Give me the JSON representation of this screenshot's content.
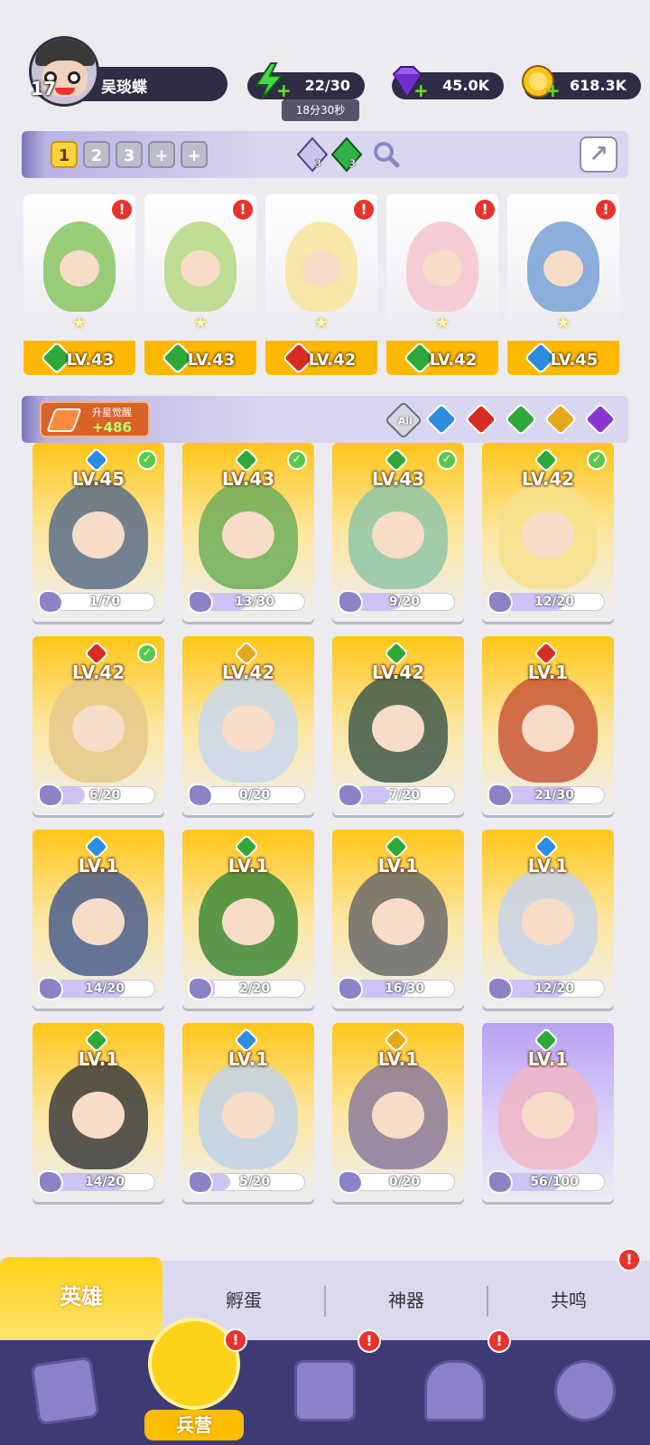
{
  "player": {
    "level": "17",
    "name": "吴琰蝶"
  },
  "resources": {
    "energy": "22/30",
    "energy_timer": "18分30秒",
    "gems": "45.0K",
    "coins": "618.3K"
  },
  "team_tabs": [
    "1",
    "2",
    "3",
    "+",
    "+"
  ],
  "team_gems": {
    "purple_count": "3",
    "green_count": "3"
  },
  "team": [
    {
      "level": "LV.43",
      "element": "green"
    },
    {
      "level": "LV.43",
      "element": "green"
    },
    {
      "level": "LV.42",
      "element": "fire"
    },
    {
      "level": "LV.42",
      "element": "green"
    },
    {
      "level": "LV.45",
      "element": "water"
    }
  ],
  "awaken": {
    "label": "升星觉醒",
    "value": "+486"
  },
  "filters": {
    "all_label": "All",
    "elements": [
      "water",
      "fire",
      "green",
      "light",
      "dark"
    ]
  },
  "heroes": [
    {
      "level": "LV.45",
      "element": "water",
      "shards": "1/70",
      "progress": 0.014,
      "checked": true
    },
    {
      "level": "LV.43",
      "element": "green",
      "shards": "13/30",
      "progress": 0.43,
      "checked": true
    },
    {
      "level": "LV.43",
      "element": "green",
      "shards": "9/20",
      "progress": 0.45,
      "checked": true
    },
    {
      "level": "LV.42",
      "element": "green",
      "shards": "12/20",
      "progress": 0.6,
      "checked": true
    },
    {
      "level": "LV.42",
      "element": "fire",
      "shards": "6/20",
      "progress": 0.3,
      "checked": true
    },
    {
      "level": "LV.42",
      "element": "light",
      "shards": "0/20",
      "progress": 0.0,
      "checked": false
    },
    {
      "level": "LV.42",
      "element": "green",
      "shards": "7/20",
      "progress": 0.35,
      "checked": false
    },
    {
      "level": "LV.1",
      "element": "fire",
      "shards": "21/30",
      "progress": 0.7,
      "checked": false
    },
    {
      "level": "LV.1",
      "element": "water",
      "shards": "14/20",
      "progress": 0.7,
      "checked": false
    },
    {
      "level": "LV.1",
      "element": "green",
      "shards": "2/20",
      "progress": 0.1,
      "checked": false
    },
    {
      "level": "LV.1",
      "element": "green",
      "shards": "16/30",
      "progress": 0.53,
      "checked": false
    },
    {
      "level": "LV.1",
      "element": "water",
      "shards": "12/20",
      "progress": 0.6,
      "checked": false
    },
    {
      "level": "LV.1",
      "element": "green",
      "shards": "14/20",
      "progress": 0.7,
      "checked": false
    },
    {
      "level": "LV.1",
      "element": "water",
      "shards": "5/20",
      "progress": 0.25,
      "checked": false
    },
    {
      "level": "LV.1",
      "element": "light",
      "shards": "0/20",
      "progress": 0.0,
      "checked": false
    },
    {
      "level": "LV.1",
      "element": "green",
      "shards": "56/100",
      "progress": 0.56,
      "checked": false
    }
  ],
  "subtabs": [
    "英雄",
    "孵蛋",
    "神器",
    "共鸣"
  ],
  "nav": {
    "active_label": "兵营"
  },
  "colors": {
    "green": "#2fa83a",
    "fire": "#d52c23",
    "water": "#2d8de0",
    "light": "#e5a81a",
    "dark": "#8a37d2",
    "gold": "#ffc619",
    "navbar": "#3e3b74"
  }
}
